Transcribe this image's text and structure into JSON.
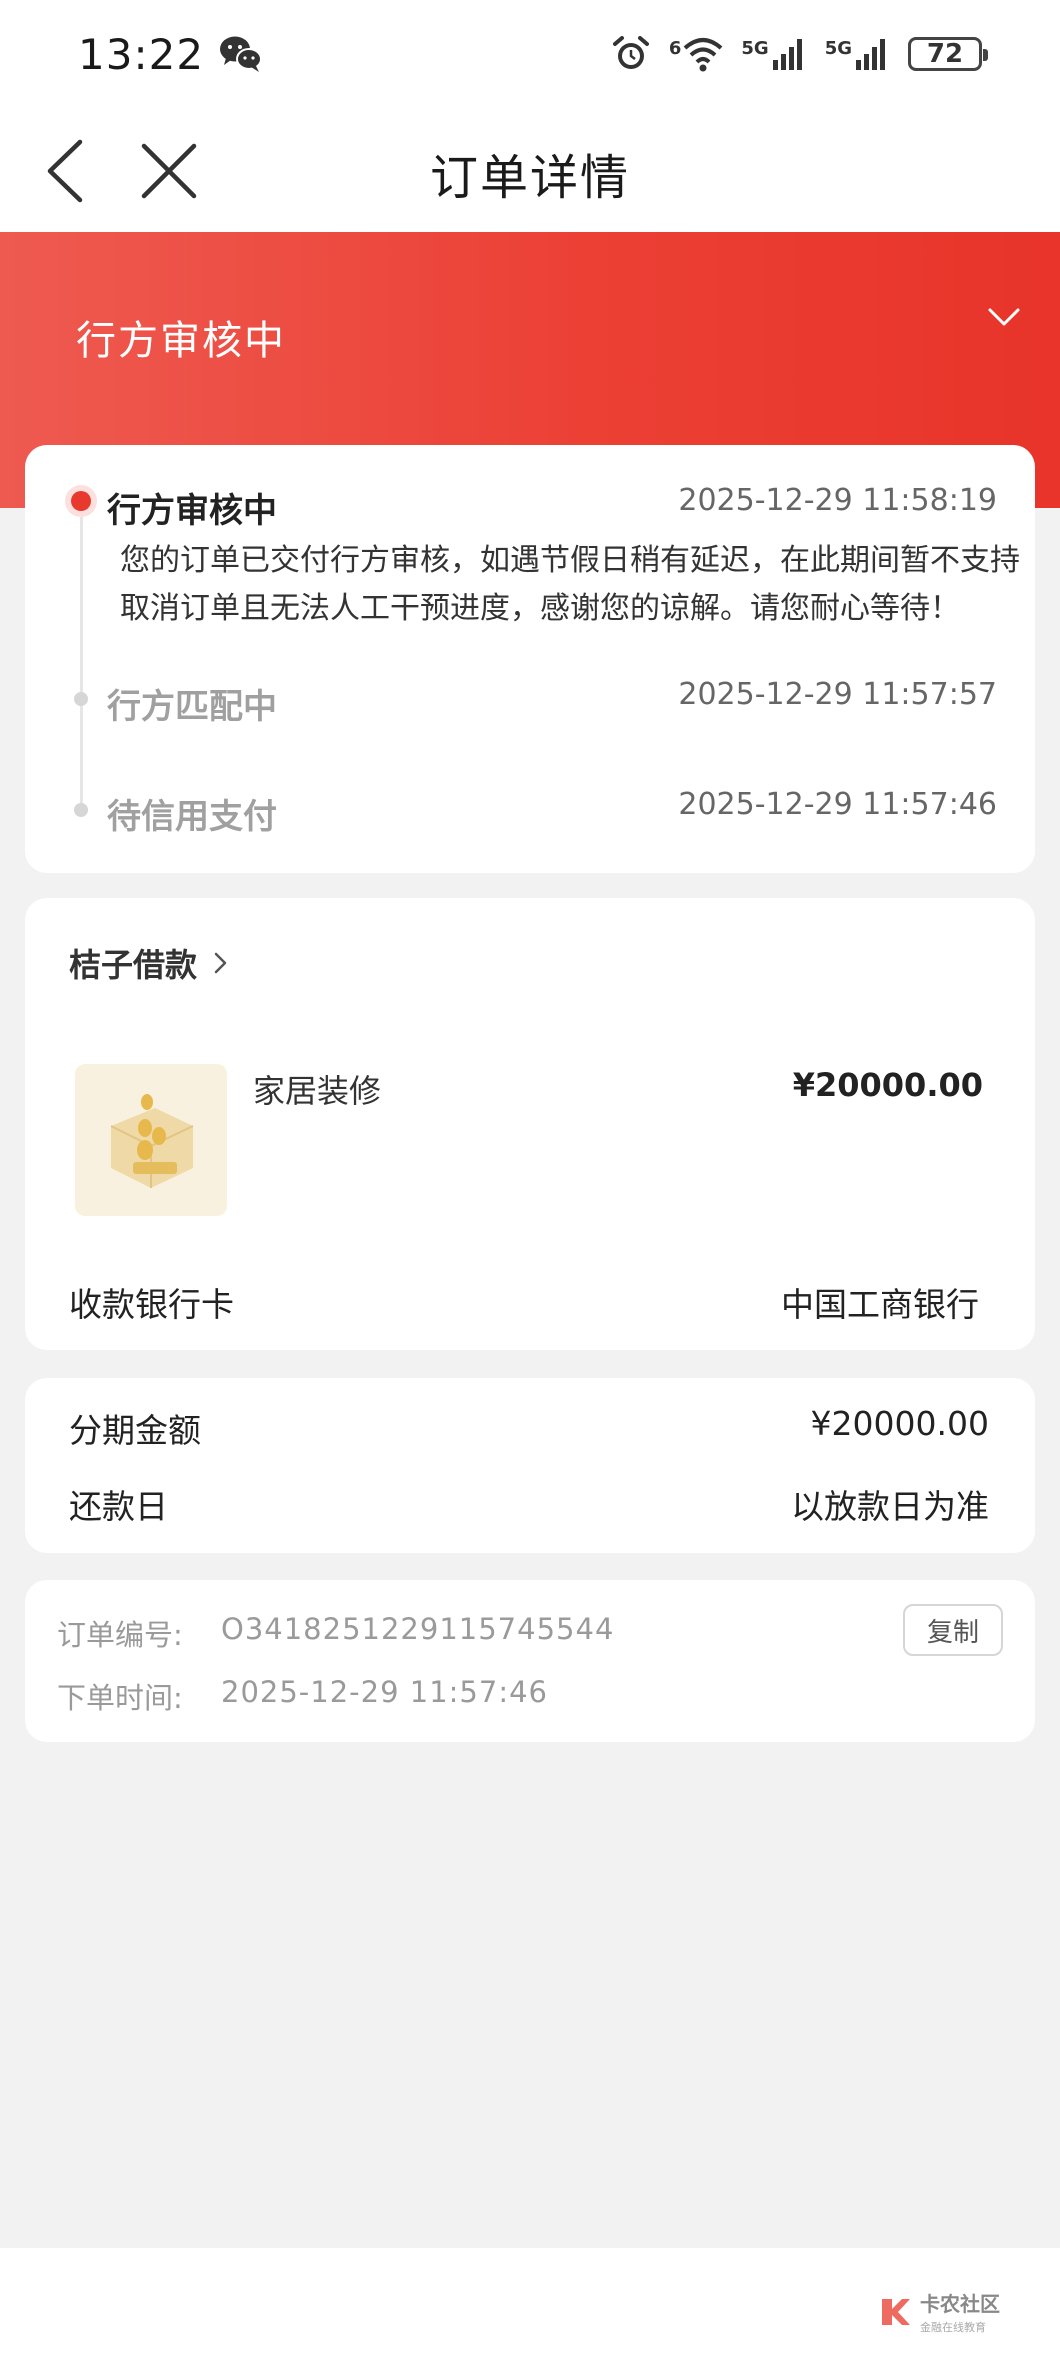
{
  "status_bar": {
    "time": "13:22",
    "wifi_label": "6",
    "sim1_label": "5G",
    "sim2_label": "5G",
    "battery": "72",
    "icons": [
      "wechat-icon",
      "alarm-icon",
      "wifi-icon",
      "signal-icon",
      "signal-icon",
      "battery-icon"
    ]
  },
  "nav": {
    "title": "订单详情",
    "icons": [
      "back-icon",
      "close-icon"
    ]
  },
  "banner": {
    "status": "行方审核中",
    "icon": "chevron-down-icon"
  },
  "timeline": {
    "steps": [
      {
        "title": "行方审核中",
        "time": "2025-12-29 11:58:19",
        "desc": "您的订单已交付行方审核，如遇节假日稍有延迟，在此期间暂不支持取消订单且无法人工干预进度，感谢您的谅解。请您耐心等待！",
        "active": true
      },
      {
        "title": "行方匹配中",
        "time": "2025-12-29 11:57:57",
        "active": false
      },
      {
        "title": "待信用支付",
        "time": "2025-12-29 11:57:46",
        "active": false
      }
    ]
  },
  "product": {
    "vendor": "桔子借款",
    "name": "家居装修",
    "price": "¥20000.00",
    "bank_label": "收款银行卡",
    "bank_value": "中国工商银行"
  },
  "amount": {
    "installment_label": "分期金额",
    "installment_value": "¥20000.00",
    "repay_label": "还款日",
    "repay_value": "以放款日为准"
  },
  "order": {
    "number_label": "订单编号:",
    "number_value": "O3418251229115745544",
    "time_label": "下单时间:",
    "time_value": "2025-12-29 11:57:46",
    "copy_label": "复制"
  },
  "watermark": {
    "title": "卡农社区",
    "subtitle": "金融在线教育"
  },
  "colors": {
    "accent": "#e8392e",
    "banner_start": "#ee5a50",
    "banner_end": "#e8342a",
    "background": "#f2f2f2"
  }
}
